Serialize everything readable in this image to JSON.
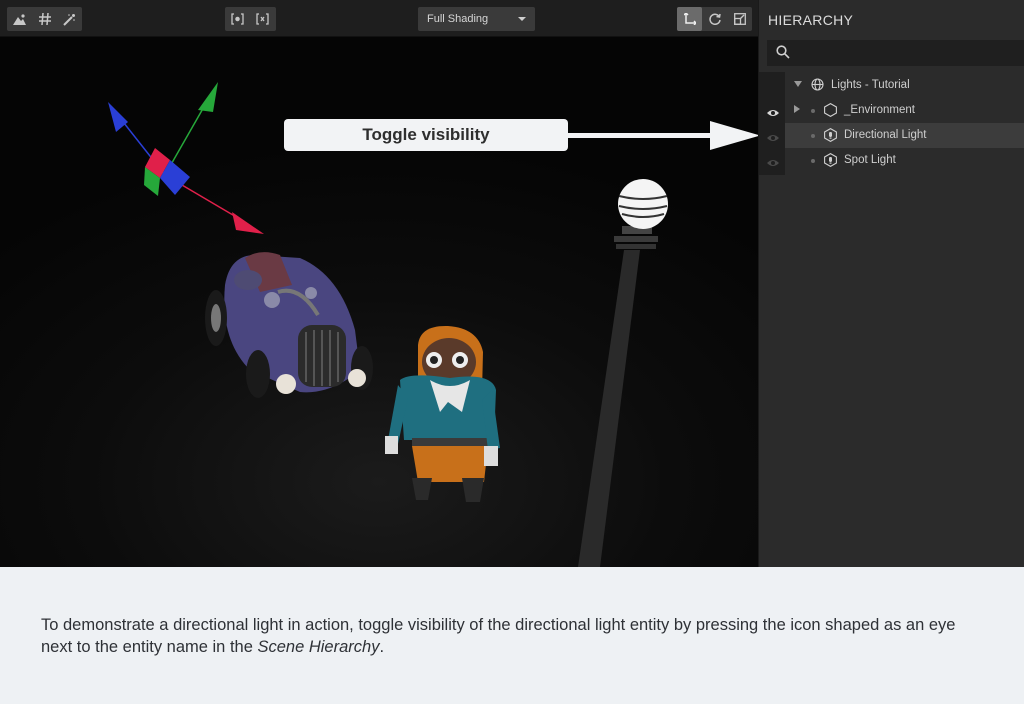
{
  "toolbar": {
    "shading_label": "Full Shading"
  },
  "hierarchy": {
    "title": "HIERARCHY",
    "items": [
      {
        "label": "Lights - Tutorial",
        "icon": "globe-icon"
      },
      {
        "label": "_Environment",
        "icon": "hexagon-icon"
      },
      {
        "label": "Directional Light",
        "icon": "light-entity-icon"
      },
      {
        "label": "Spot Light",
        "icon": "light-entity-icon"
      }
    ]
  },
  "callout": {
    "text": "Toggle visibility"
  },
  "caption": {
    "text_before": "To demonstrate a directional light in action, toggle visibility of the directional light entity by pressing the icon shaped as an eye next to the entity name in the ",
    "emphasis": "Scene Hierarchy",
    "text_after": "."
  },
  "colors": {
    "panel_bg": "#2b2b2b",
    "toolbar_bg": "#1e1e1e",
    "selected_row": "#3c3c3c",
    "caption_bg": "#eef1f4",
    "gizmo_x": "#e0204a",
    "gizmo_y": "#26a83a",
    "gizmo_z": "#2a3fd6"
  }
}
